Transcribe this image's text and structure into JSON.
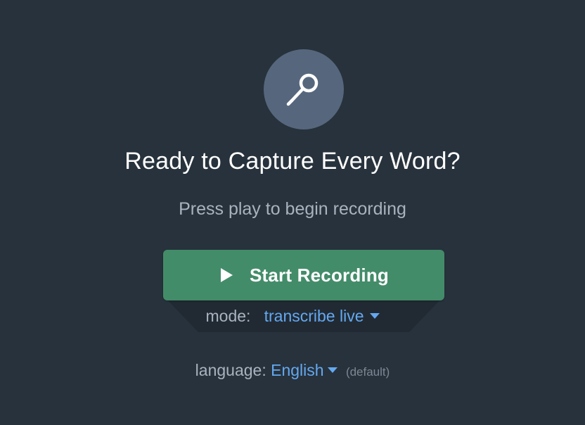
{
  "hero": {
    "icon": "microphone-icon",
    "title": "Ready to Capture Every Word?",
    "subtitle": "Press play to begin recording"
  },
  "start_button": {
    "label": "Start Recording",
    "icon": "play-icon"
  },
  "mode": {
    "key": "mode:",
    "value": "transcribe live"
  },
  "language": {
    "key": "language:",
    "value": "English",
    "note": "(default)"
  },
  "colors": {
    "background": "#27323c",
    "accent_green": "#438c69",
    "link_blue": "#64a8f0",
    "mic_circle": "#56677d"
  }
}
